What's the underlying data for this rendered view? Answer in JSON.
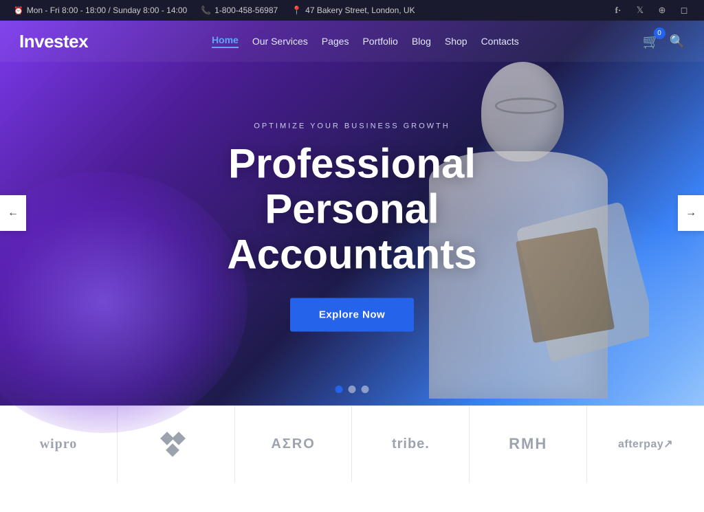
{
  "topbar": {
    "hours": "Mon - Fri 8:00 - 18:00 / Sunday 8:00 - 14:00",
    "phone": "1-800-458-56987",
    "address": "47 Bakery Street, London, UK"
  },
  "header": {
    "logo": "Investex",
    "nav": [
      {
        "label": "Home",
        "active": true
      },
      {
        "label": "Our Services",
        "active": false
      },
      {
        "label": "Pages",
        "active": false
      },
      {
        "label": "Portfolio",
        "active": false
      },
      {
        "label": "Blog",
        "active": false
      },
      {
        "label": "Shop",
        "active": false
      },
      {
        "label": "Contacts",
        "active": false
      }
    ],
    "cart_count": "0"
  },
  "hero": {
    "subtitle": "OPTIMIZE YOUR BUSINESS GROWTH",
    "title_line1": "Professional Personal",
    "title_line2": "Accountants",
    "cta_label": "Explore Now",
    "dots": [
      {
        "active": true
      },
      {
        "active": false
      },
      {
        "active": false
      }
    ],
    "prev_arrow": "←",
    "next_arrow": "→"
  },
  "brands": [
    {
      "name": "wipro",
      "display": "wipro"
    },
    {
      "name": "diamonds",
      "display": "◇◇◇"
    },
    {
      "name": "aero",
      "display": "AΣRO"
    },
    {
      "name": "tribe",
      "display": "tribe."
    },
    {
      "name": "rmh",
      "display": "RMH"
    },
    {
      "name": "afterpay",
      "display": "afterpay→"
    }
  ],
  "icons": {
    "clock": "🕐",
    "phone": "📞",
    "location": "📍",
    "facebook": "f",
    "twitter": "𝕏",
    "globe": "⊕",
    "instagram": "◻",
    "search": "🔍",
    "cart": "🛒"
  }
}
